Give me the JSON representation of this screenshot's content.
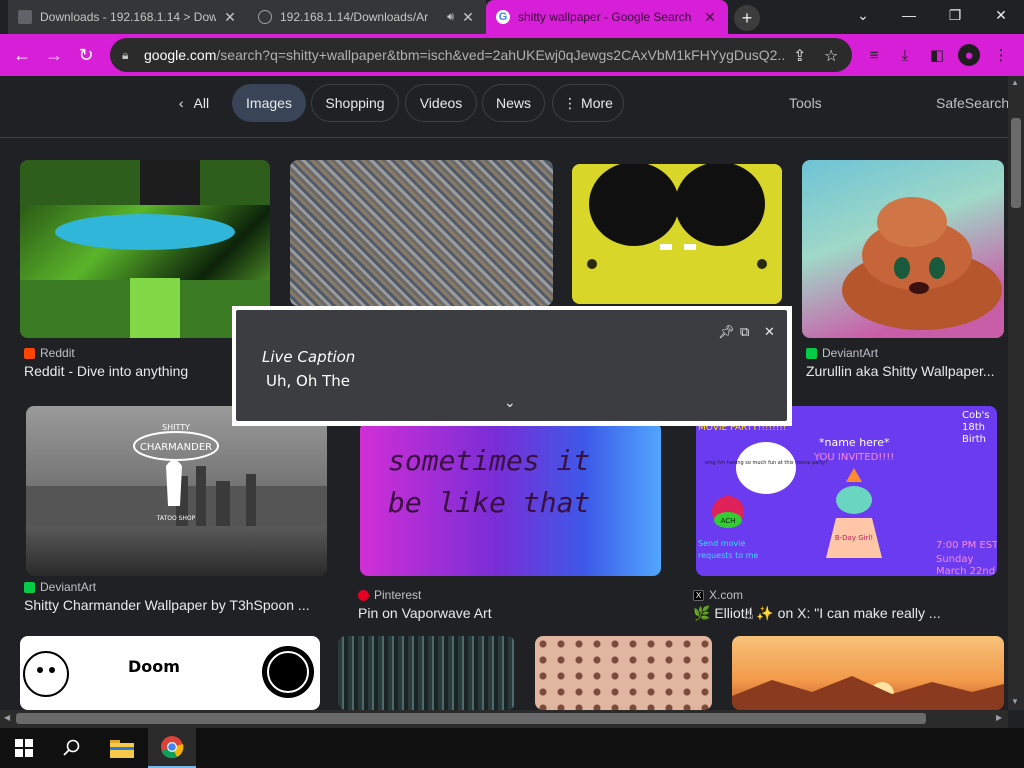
{
  "tabs": [
    {
      "title": "Downloads - 192.168.1.14 > Dow",
      "active": false
    },
    {
      "title": "192.168.1.14/Downloads/Ar",
      "active": false
    },
    {
      "title": "shitty wallpaper - Google Search",
      "active": true
    }
  ],
  "new_tab_label": "+",
  "window": {
    "minimize": "—",
    "maximize": "❐",
    "close": "✕",
    "tab_search": "⌄"
  },
  "omnibox": {
    "host": "google.com",
    "rest": "/search?q=shitty+wallpaper&tbm=isch&ved=2ahUKEwj0qJewgs2CAxVbM1kFHYygDusQ2..."
  },
  "filters": {
    "back_label": "All",
    "chips": [
      "Images",
      "Shopping",
      "Videos",
      "News",
      "More"
    ],
    "selected": "Images",
    "tools": "Tools",
    "safesearch": "SafeSearch"
  },
  "results": [
    {
      "source": "Reddit",
      "title": "Reddit - Dive into anything",
      "source_color": "#ff4500"
    },
    {
      "source": "",
      "title": "",
      "source_color": "#888888"
    },
    {
      "source": "",
      "title": "",
      "source_color": "#888888"
    },
    {
      "source": "DeviantArt",
      "title": "Zurullin aka Shitty Wallpaper...",
      "source_color": "#05cc47"
    },
    {
      "source": "DeviantArt",
      "title": "Shitty Charmander Wallpaper by T3hSpoon ...",
      "source_color": "#05cc47"
    },
    {
      "source": "Pinterest",
      "title": "Pin on Vaporwave Art",
      "source_color": "#e60023"
    },
    {
      "source": "X.com",
      "title": "🌿 Elliot!! ✨ on X: \"I can make really ...",
      "source_color": "#000000"
    }
  ],
  "image_text": {
    "sometimes": "sometimes it",
    "be_like": "be like that",
    "charmander_top": "SHITTY",
    "charmander_name": "CHARMANDER",
    "tatoo": "TATOO SHOP",
    "movie_party": "MOVIE PARTY!!!!!!!!",
    "name_here": "*name here*",
    "you_invited": "YOU INVITED!!!!",
    "cobs": "Cob's",
    "eighteenth": "18th",
    "birth": "Birth",
    "bubble": "omg I'm having so much fun at this movie party!",
    "ach": "ACH",
    "send_movie": "Send movie",
    "requests": "requests to me",
    "time": "7:00 PM EST",
    "sunday": "Sunday",
    "march": "March 22nd",
    "bday_girl": "B-Day Girl!",
    "doom": "Doom"
  },
  "live_caption": {
    "title": "Live Caption",
    "text": "Uh, Oh The"
  },
  "colors": {
    "accent": "#d61fd6",
    "page_bg": "#202124",
    "chip_selected": "#394457"
  }
}
